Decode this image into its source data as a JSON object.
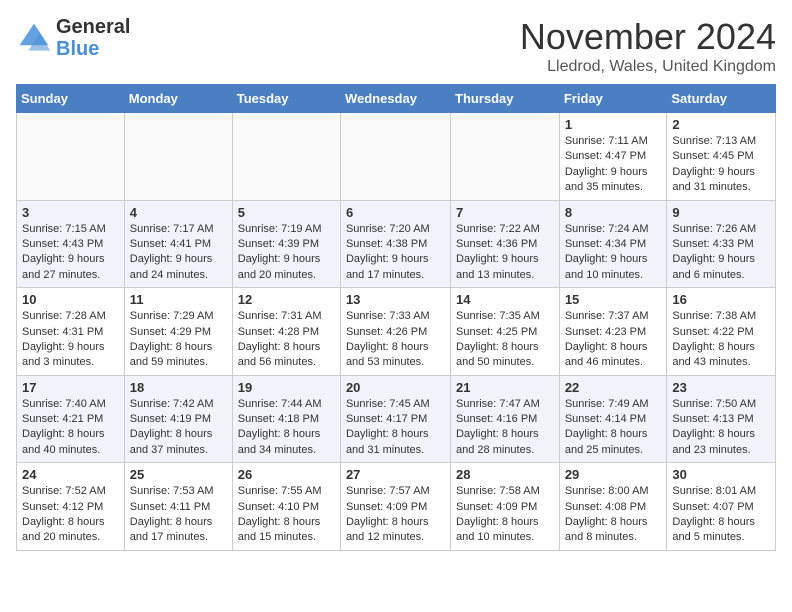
{
  "header": {
    "logo_line1": "General",
    "logo_line2": "Blue",
    "month_title": "November 2024",
    "location": "Lledrod, Wales, United Kingdom"
  },
  "days_of_week": [
    "Sunday",
    "Monday",
    "Tuesday",
    "Wednesday",
    "Thursday",
    "Friday",
    "Saturday"
  ],
  "weeks": [
    [
      {
        "day": null
      },
      {
        "day": null
      },
      {
        "day": null
      },
      {
        "day": null
      },
      {
        "day": null
      },
      {
        "day": "1",
        "sunrise": "7:11 AM",
        "sunset": "4:47 PM",
        "daylight": "9 hours and 35 minutes."
      },
      {
        "day": "2",
        "sunrise": "7:13 AM",
        "sunset": "4:45 PM",
        "daylight": "9 hours and 31 minutes."
      }
    ],
    [
      {
        "day": "3",
        "sunrise": "7:15 AM",
        "sunset": "4:43 PM",
        "daylight": "9 hours and 27 minutes."
      },
      {
        "day": "4",
        "sunrise": "7:17 AM",
        "sunset": "4:41 PM",
        "daylight": "9 hours and 24 minutes."
      },
      {
        "day": "5",
        "sunrise": "7:19 AM",
        "sunset": "4:39 PM",
        "daylight": "9 hours and 20 minutes."
      },
      {
        "day": "6",
        "sunrise": "7:20 AM",
        "sunset": "4:38 PM",
        "daylight": "9 hours and 17 minutes."
      },
      {
        "day": "7",
        "sunrise": "7:22 AM",
        "sunset": "4:36 PM",
        "daylight": "9 hours and 13 minutes."
      },
      {
        "day": "8",
        "sunrise": "7:24 AM",
        "sunset": "4:34 PM",
        "daylight": "9 hours and 10 minutes."
      },
      {
        "day": "9",
        "sunrise": "7:26 AM",
        "sunset": "4:33 PM",
        "daylight": "9 hours and 6 minutes."
      }
    ],
    [
      {
        "day": "10",
        "sunrise": "7:28 AM",
        "sunset": "4:31 PM",
        "daylight": "9 hours and 3 minutes."
      },
      {
        "day": "11",
        "sunrise": "7:29 AM",
        "sunset": "4:29 PM",
        "daylight": "8 hours and 59 minutes."
      },
      {
        "day": "12",
        "sunrise": "7:31 AM",
        "sunset": "4:28 PM",
        "daylight": "8 hours and 56 minutes."
      },
      {
        "day": "13",
        "sunrise": "7:33 AM",
        "sunset": "4:26 PM",
        "daylight": "8 hours and 53 minutes."
      },
      {
        "day": "14",
        "sunrise": "7:35 AM",
        "sunset": "4:25 PM",
        "daylight": "8 hours and 50 minutes."
      },
      {
        "day": "15",
        "sunrise": "7:37 AM",
        "sunset": "4:23 PM",
        "daylight": "8 hours and 46 minutes."
      },
      {
        "day": "16",
        "sunrise": "7:38 AM",
        "sunset": "4:22 PM",
        "daylight": "8 hours and 43 minutes."
      }
    ],
    [
      {
        "day": "17",
        "sunrise": "7:40 AM",
        "sunset": "4:21 PM",
        "daylight": "8 hours and 40 minutes."
      },
      {
        "day": "18",
        "sunrise": "7:42 AM",
        "sunset": "4:19 PM",
        "daylight": "8 hours and 37 minutes."
      },
      {
        "day": "19",
        "sunrise": "7:44 AM",
        "sunset": "4:18 PM",
        "daylight": "8 hours and 34 minutes."
      },
      {
        "day": "20",
        "sunrise": "7:45 AM",
        "sunset": "4:17 PM",
        "daylight": "8 hours and 31 minutes."
      },
      {
        "day": "21",
        "sunrise": "7:47 AM",
        "sunset": "4:16 PM",
        "daylight": "8 hours and 28 minutes."
      },
      {
        "day": "22",
        "sunrise": "7:49 AM",
        "sunset": "4:14 PM",
        "daylight": "8 hours and 25 minutes."
      },
      {
        "day": "23",
        "sunrise": "7:50 AM",
        "sunset": "4:13 PM",
        "daylight": "8 hours and 23 minutes."
      }
    ],
    [
      {
        "day": "24",
        "sunrise": "7:52 AM",
        "sunset": "4:12 PM",
        "daylight": "8 hours and 20 minutes."
      },
      {
        "day": "25",
        "sunrise": "7:53 AM",
        "sunset": "4:11 PM",
        "daylight": "8 hours and 17 minutes."
      },
      {
        "day": "26",
        "sunrise": "7:55 AM",
        "sunset": "4:10 PM",
        "daylight": "8 hours and 15 minutes."
      },
      {
        "day": "27",
        "sunrise": "7:57 AM",
        "sunset": "4:09 PM",
        "daylight": "8 hours and 12 minutes."
      },
      {
        "day": "28",
        "sunrise": "7:58 AM",
        "sunset": "4:09 PM",
        "daylight": "8 hours and 10 minutes."
      },
      {
        "day": "29",
        "sunrise": "8:00 AM",
        "sunset": "4:08 PM",
        "daylight": "8 hours and 8 minutes."
      },
      {
        "day": "30",
        "sunrise": "8:01 AM",
        "sunset": "4:07 PM",
        "daylight": "8 hours and 5 minutes."
      }
    ]
  ]
}
